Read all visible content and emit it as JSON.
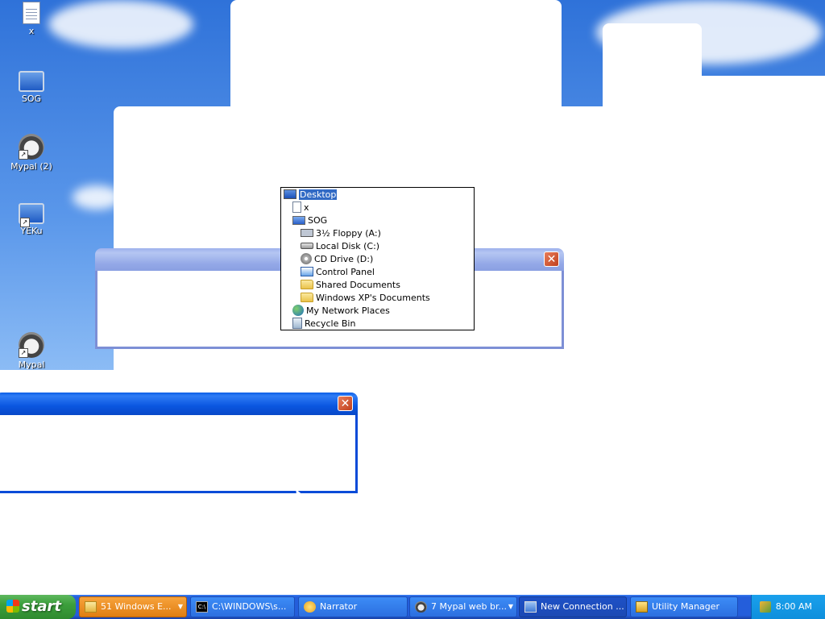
{
  "desktop": {
    "icons": [
      {
        "label": "x",
        "icon": "text-file-icon"
      },
      {
        "label": "SOG",
        "icon": "computer-icon"
      },
      {
        "label": "Mypal (2)",
        "icon": "raccoon-icon"
      },
      {
        "label": "YEKu",
        "icon": "computer-icon"
      },
      {
        "label": "Mypal",
        "icon": "raccoon-icon"
      }
    ]
  },
  "location_tree": {
    "items": [
      {
        "label": "Desktop",
        "icon": "desktop-icon",
        "selected": true
      },
      {
        "label": "x",
        "icon": "text-file-icon"
      },
      {
        "label": "SOG",
        "icon": "computer-icon"
      },
      {
        "label": "3½ Floppy (A:)",
        "icon": "floppy-icon"
      },
      {
        "label": "Local Disk (C:)",
        "icon": "disk-icon"
      },
      {
        "label": "CD Drive (D:)",
        "icon": "cd-icon"
      },
      {
        "label": "Control Panel",
        "icon": "control-panel-icon"
      },
      {
        "label": "Shared Documents",
        "icon": "folder-icon"
      },
      {
        "label": "Windows XP's Documents",
        "icon": "folder-icon"
      },
      {
        "label": "My Network Places",
        "icon": "network-icon"
      },
      {
        "label": "Recycle Bin",
        "icon": "recycle-bin-icon"
      }
    ]
  },
  "dialogs": {
    "close_glyph": "✕"
  },
  "taskbar": {
    "start_label": "start",
    "tasks": [
      {
        "label": "51 Windows E...",
        "icon": "folder-icon",
        "has_arrow": true
      },
      {
        "label": "C:\\WINDOWS\\s...",
        "icon": "command-prompt-icon",
        "icon_text": "C:\\"
      },
      {
        "label": "Narrator",
        "icon": "narrator-icon"
      },
      {
        "label": "7 Mypal web br...",
        "icon": "raccoon-icon",
        "has_arrow": true
      },
      {
        "label": "New Connection ...",
        "icon": "connection-icon",
        "active": true
      },
      {
        "label": "Utility Manager",
        "icon": "utility-manager-icon"
      }
    ],
    "arrow_glyph": "▼",
    "clock": "8:00 AM"
  },
  "colors": {
    "xp_blue": "#245edb",
    "selection": "#316ac5",
    "start_green": "#3c9f3c"
  }
}
